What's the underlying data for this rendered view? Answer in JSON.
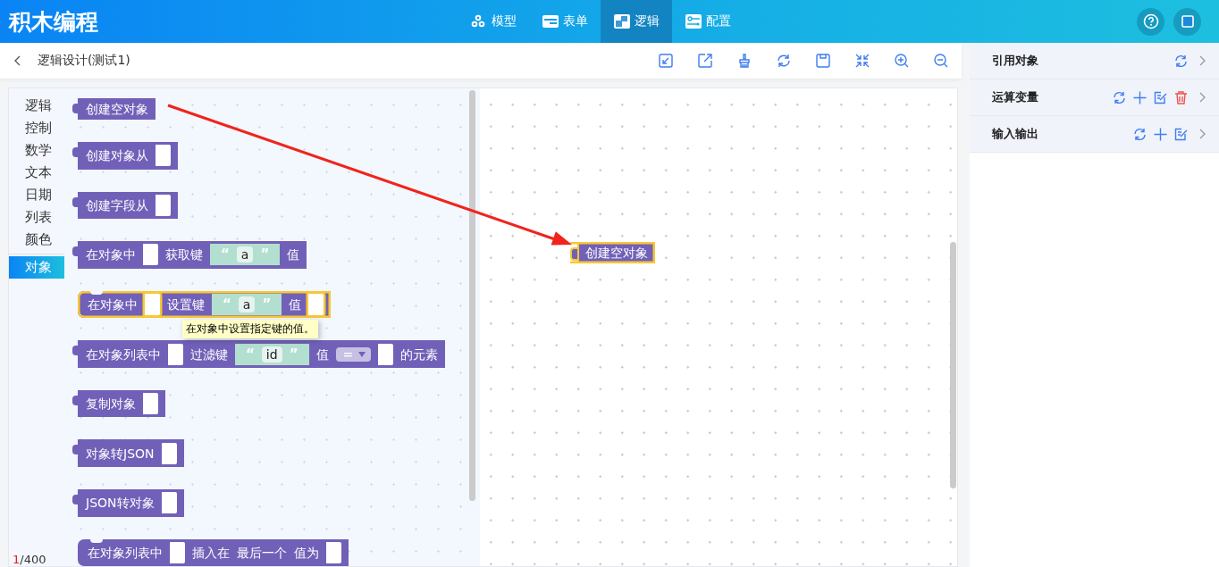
{
  "app": {
    "title": "积木编程"
  },
  "nav_tabs": [
    {
      "label": "模型",
      "selected": false
    },
    {
      "label": "表单",
      "selected": false
    },
    {
      "label": "逻辑",
      "selected": true
    },
    {
      "label": "配置",
      "selected": false
    }
  ],
  "page": {
    "title": "逻辑设计(测试1)"
  },
  "categories": [
    {
      "label": "逻辑",
      "selected": false
    },
    {
      "label": "控制",
      "selected": false
    },
    {
      "label": "数学",
      "selected": false
    },
    {
      "label": "文本",
      "selected": false
    },
    {
      "label": "日期",
      "selected": false
    },
    {
      "label": "列表",
      "selected": false
    },
    {
      "label": "颜色",
      "selected": false
    },
    {
      "label": "对象",
      "selected": true
    }
  ],
  "flyout_blocks": [
    {
      "kind": "value",
      "selected": false,
      "parts": [
        {
          "kind": "text",
          "text": "创建空对象"
        }
      ]
    },
    {
      "kind": "value",
      "selected": false,
      "parts": [
        {
          "kind": "text",
          "text": "创建对象从"
        },
        {
          "kind": "slot"
        }
      ]
    },
    {
      "kind": "value",
      "selected": false,
      "parts": [
        {
          "kind": "text",
          "text": "创建字段从"
        },
        {
          "kind": "slot"
        }
      ]
    },
    {
      "kind": "value",
      "selected": false,
      "parts": [
        {
          "kind": "text",
          "text": "在对象中"
        },
        {
          "kind": "slot"
        },
        {
          "kind": "text",
          "text": "获取键"
        },
        {
          "kind": "string",
          "open_quote": "“",
          "value": "a",
          "close_quote": "”"
        },
        {
          "kind": "text",
          "text": "值"
        }
      ]
    },
    {
      "kind": "statement",
      "selected": true,
      "parts": [
        {
          "kind": "text",
          "text": "在对象中"
        },
        {
          "kind": "slot"
        },
        {
          "kind": "text",
          "text": "设置键"
        },
        {
          "kind": "string",
          "open_quote": "“",
          "value": "a",
          "close_quote": "”"
        },
        {
          "kind": "text",
          "text": "值"
        },
        {
          "kind": "slot"
        }
      ]
    },
    {
      "kind": "value",
      "selected": false,
      "parts": [
        {
          "kind": "text",
          "text": "在对象列表中"
        },
        {
          "kind": "slot"
        },
        {
          "kind": "text",
          "text": "过滤键"
        },
        {
          "kind": "string",
          "open_quote": "“",
          "value": "id",
          "close_quote": "”"
        },
        {
          "kind": "text",
          "text": "值"
        },
        {
          "kind": "dropdown",
          "value": "="
        },
        {
          "kind": "slot"
        },
        {
          "kind": "text",
          "text": "的元素"
        }
      ]
    },
    {
      "kind": "value",
      "selected": false,
      "parts": [
        {
          "kind": "text",
          "text": "复制对象"
        },
        {
          "kind": "slot"
        }
      ]
    },
    {
      "kind": "value",
      "selected": false,
      "parts": [
        {
          "kind": "text",
          "text": "对象转JSON"
        },
        {
          "kind": "slot"
        }
      ]
    },
    {
      "kind": "value",
      "selected": false,
      "parts": [
        {
          "kind": "text",
          "text": "JSON转对象"
        },
        {
          "kind": "slot"
        }
      ]
    },
    {
      "kind": "statement",
      "selected": false,
      "parts": [
        {
          "kind": "text",
          "text": "在对象列表中"
        },
        {
          "kind": "slot"
        },
        {
          "kind": "text",
          "text": "插入在"
        },
        {
          "kind": "text",
          "text": "最后一个"
        },
        {
          "kind": "text",
          "text": "值为"
        },
        {
          "kind": "slot"
        }
      ]
    }
  ],
  "tooltip": {
    "text": "在对象中设置指定键的值。"
  },
  "counter": {
    "current": "1",
    "rest": "/400"
  },
  "canvas_blocks": [
    {
      "kind": "value",
      "selected": true,
      "parts": [
        {
          "kind": "text",
          "text": "创建空对象"
        }
      ]
    }
  ],
  "side_panel": [
    {
      "title": "引用对象"
    },
    {
      "title": "运算变量"
    },
    {
      "title": "输入输出"
    }
  ]
}
